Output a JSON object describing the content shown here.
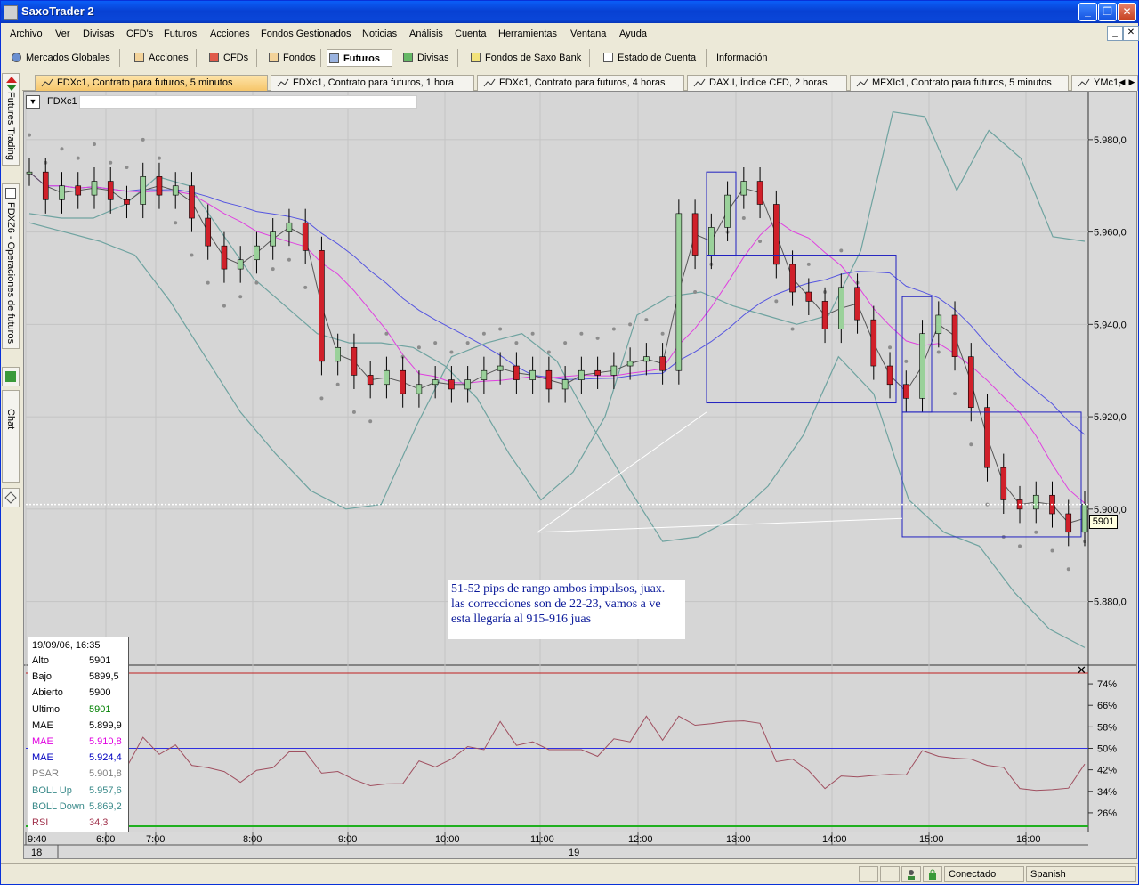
{
  "window": {
    "title": "SaxoTrader 2"
  },
  "menu": [
    "Archivo",
    "Ver",
    "Divisas",
    "CFD's",
    "Futuros",
    "Acciones",
    "Fondos Gestionados",
    "Noticias",
    "Análisis",
    "Cuenta",
    "Herramientas",
    "Ventana",
    "Ayuda"
  ],
  "toolbar": [
    "Mercados Globales",
    "Acciones",
    "CFDs",
    "Fondos",
    "Futuros",
    "Divisas",
    "Fondos de Saxo Bank",
    "Estado de Cuenta",
    "Información"
  ],
  "toolbar_active": "Futuros",
  "tabs": [
    "FDXc1, Contrato para futuros, 5 minutos",
    "FDXc1, Contrato para futuros, 1 hora",
    "FDXc1, Contrato para futuros, 4 horas",
    "DAX.I, Índice CFD, 2 horas",
    "MFXIc1, Contrato para futuros, 5 minutos",
    "YMc1,"
  ],
  "sidebar": [
    "Futures Trading",
    "FDXZ6 - Operaciones de futuros",
    "Chat"
  ],
  "chart": {
    "symbol": "FDXc1",
    "current_price": "5901",
    "annotation": [
      "51-52 pips de rango ambos impulsos, juax.",
      "las correcciones son de 22-23, vamos a ve",
      "esta llegaría al 915-916 juas"
    ],
    "date_labels": [
      "18",
      "19"
    ]
  },
  "info_box": {
    "header": "19/09/06, 16:35",
    "rows": [
      {
        "k": "Alto",
        "v": "5901",
        "kc": "#000000",
        "vc": "#000000"
      },
      {
        "k": "Bajo",
        "v": "5899,5",
        "kc": "#000000",
        "vc": "#000000"
      },
      {
        "k": "Abierto",
        "v": "5900",
        "kc": "#000000",
        "vc": "#000000"
      },
      {
        "k": "Ultimo",
        "v": "5901",
        "kc": "#000000",
        "vc": "#008000"
      },
      {
        "k": "MAE",
        "v": "5.899,9",
        "kc": "#000000",
        "vc": "#000000"
      },
      {
        "k": "MAE",
        "v": "5.910,8",
        "kc": "#e000e0",
        "vc": "#e000e0"
      },
      {
        "k": "MAE",
        "v": "5.924,4",
        "kc": "#0000c0",
        "vc": "#0000c0"
      },
      {
        "k": "PSAR",
        "v": "5.901,8",
        "kc": "#808080",
        "vc": "#808080"
      },
      {
        "k": "BOLL Up",
        "v": "5.957,6",
        "kc": "#3a8a8a",
        "vc": "#3a8a8a"
      },
      {
        "k": "BOLL Down",
        "v": "5.869,2",
        "kc": "#3a8a8a",
        "vc": "#3a8a8a"
      },
      {
        "k": "RSI",
        "v": "34,3",
        "kc": "#a0304a",
        "vc": "#a0304a"
      }
    ]
  },
  "status": {
    "connection": "Conectado",
    "language": "Spanish"
  },
  "chart_data": {
    "type": "line",
    "title": "",
    "x_ticks": [
      "9:40",
      "6:00",
      "7:00",
      "8:00",
      "9:00",
      "10:00",
      "11:00",
      "12:00",
      "13:00",
      "14:00",
      "15:00",
      "16:00"
    ],
    "y_ticks": [
      5980,
      5960,
      5940,
      5920,
      5900,
      5880
    ],
    "y_tick_labels": [
      "5.980,0",
      "5.960,0",
      "5.940,0",
      "5.920,0",
      "5.900,0",
      "5.880,0"
    ],
    "ylim": [
      5867,
      5990
    ],
    "rsi_ticks": [
      "74%",
      "66%",
      "58%",
      "50%",
      "42%",
      "34%",
      "26%"
    ],
    "rsi_tick_values": [
      74,
      66,
      58,
      50,
      42,
      34,
      26
    ],
    "rsi_ylim": [
      20,
      79
    ],
    "series": [
      {
        "name": "Close",
        "values": [
          5973,
          5967,
          5970,
          5968,
          5971,
          5967,
          5966,
          5972,
          5968,
          5970,
          5963,
          5957,
          5952,
          5954,
          5957,
          5960,
          5962,
          5956,
          5932,
          5935,
          5929,
          5927,
          5930,
          5925,
          5927,
          5928,
          5926,
          5928,
          5930,
          5931,
          5928,
          5930,
          5926,
          5928,
          5930,
          5929,
          5931,
          5932,
          5933,
          5930,
          5964,
          5955,
          5961,
          5968,
          5971,
          5966,
          5953,
          5947,
          5945,
          5939,
          5948,
          5941,
          5931,
          5927,
          5924,
          5938,
          5942,
          5933,
          5922,
          5909,
          5902,
          5900,
          5903,
          5899,
          5895,
          5901
        ]
      },
      {
        "name": "Upper band",
        "values": [
          5964,
          5963,
          5963,
          5966,
          5972,
          5970,
          5960,
          5950,
          5944,
          5938,
          5936,
          5936,
          5935,
          5931,
          5924,
          5912,
          5902,
          5908,
          5920,
          5942,
          5946,
          5947,
          5944,
          5942,
          5940,
          5942,
          5956,
          5986,
          5985,
          5969,
          5982,
          5976,
          5959,
          5958
        ]
      },
      {
        "name": "Lower band",
        "values": [
          5962,
          5960,
          5958,
          5955,
          5945,
          5933,
          5921,
          5912,
          5904,
          5900,
          5901,
          5918,
          5933,
          5936,
          5938,
          5932,
          5918,
          5905,
          5893,
          5894,
          5898,
          5905,
          5916,
          5933,
          5925,
          5902,
          5895,
          5892,
          5882,
          5874,
          5870
        ]
      }
    ]
  }
}
